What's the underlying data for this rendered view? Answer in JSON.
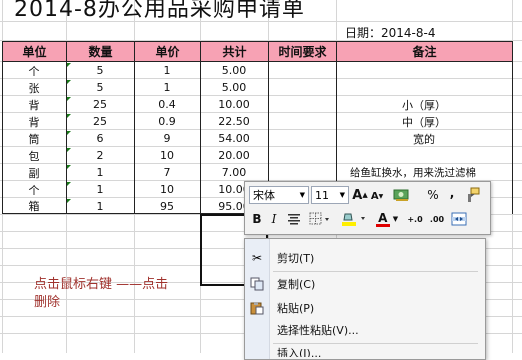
{
  "title": "2014-8办公用品采购申请单",
  "date_label": "日期：2014-8-4",
  "table": {
    "headers": [
      "单位",
      "数量",
      "单价",
      "共计",
      "时间要求",
      "备注"
    ],
    "rows": [
      [
        "个",
        "5",
        "1",
        "5.00",
        "",
        ""
      ],
      [
        "张",
        "5",
        "1",
        "5.00",
        "",
        ""
      ],
      [
        "背",
        "25",
        "0.4",
        "10.00",
        "",
        "小（厚）"
      ],
      [
        "背",
        "25",
        "0.9",
        "22.50",
        "",
        "中（厚）"
      ],
      [
        "筒",
        "6",
        "9",
        "54.00",
        "",
        "宽的"
      ],
      [
        "包",
        "2",
        "10",
        "20.00",
        "",
        ""
      ],
      [
        "副",
        "1",
        "7",
        "7.00",
        "",
        "给鱼缸换水，用来洗过滤棉"
      ],
      [
        "个",
        "1",
        "10",
        "10.00",
        "",
        ""
      ],
      [
        "箱",
        "1",
        "95",
        "95.00",
        "",
        ""
      ]
    ]
  },
  "note": [
    "点击鼠标右键 ——点击",
    "删除"
  ],
  "mini_toolbar": {
    "font_name": "宋体",
    "font_size": "11",
    "grow_font": "A",
    "shrink_font": "A",
    "percent": "%",
    "comma": ",",
    "bold": "B",
    "italic": "I",
    "decimal_increase": "+.0",
    "decimal_decrease": ".00",
    "font_color_letter": "A"
  },
  "context_menu": {
    "items": [
      {
        "label": "剪切(T)",
        "icon": "scissors-icon"
      },
      {
        "label": "复制(C)",
        "icon": "copy-icon"
      },
      {
        "label": "粘贴(P)",
        "icon": "paste-icon"
      },
      {
        "label": "选择性粘贴(V)...",
        "icon": ""
      },
      {
        "label": "插入(I)...",
        "icon": ""
      }
    ]
  },
  "colors": {
    "header_fill": "#f7a2b4",
    "note_text": "#a0322d",
    "grid": "#d6d6d6"
  }
}
